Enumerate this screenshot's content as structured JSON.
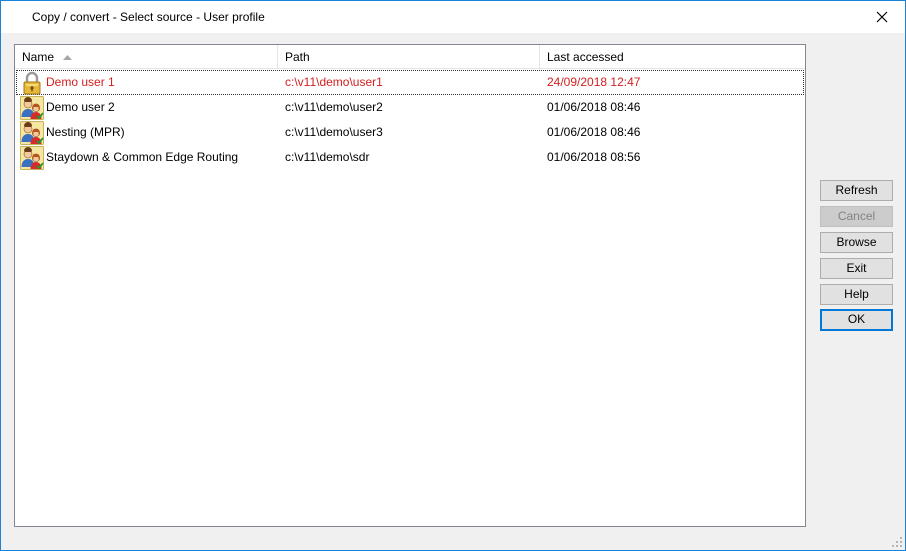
{
  "window": {
    "title": "Copy / convert - Select source - User profile"
  },
  "list": {
    "columns": {
      "name": "Name",
      "path": "Path",
      "last_accessed": "Last accessed"
    },
    "rows": [
      {
        "name": "Demo user 1",
        "path": "c:\\v11\\demo\\user1",
        "last_accessed": "24/09/2018 12:47",
        "icon": "padlock-icon",
        "highlight_color": "#d32020"
      },
      {
        "name": "Demo user 2",
        "path": "c:\\v11\\demo\\user2",
        "last_accessed": "01/06/2018 08:46",
        "icon": "user-profile-icon"
      },
      {
        "name": "Nesting (MPR)",
        "path": "c:\\v11\\demo\\user3",
        "last_accessed": "01/06/2018 08:46",
        "icon": "user-profile-icon"
      },
      {
        "name": "Staydown & Common Edge Routing",
        "path": "c:\\v11\\demo\\sdr",
        "last_accessed": "01/06/2018 08:56",
        "icon": "user-profile-icon"
      }
    ]
  },
  "buttons": {
    "refresh": "Refresh",
    "cancel": "Cancel",
    "browse": "Browse",
    "exit": "Exit",
    "help": "Help",
    "ok": "OK"
  },
  "colors": {
    "accent": "#0078d7",
    "window_border": "#1883d7",
    "locked_row_text": "#d32020"
  }
}
